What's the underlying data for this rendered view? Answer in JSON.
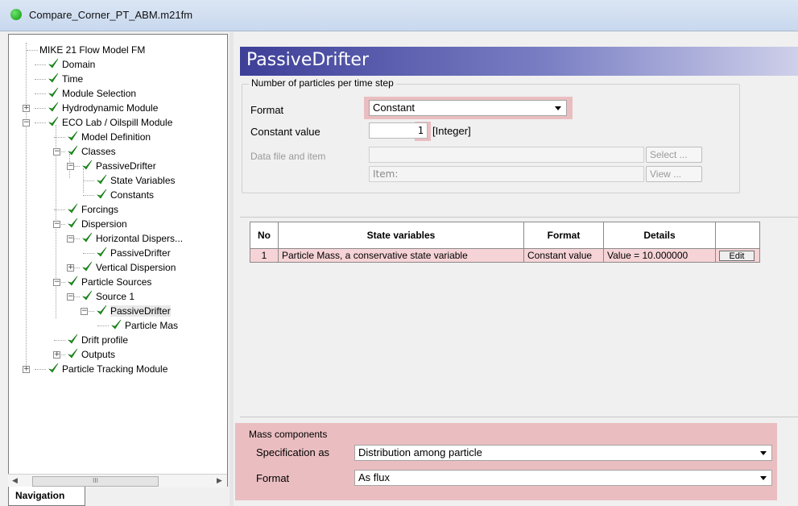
{
  "window": {
    "title": "Compare_Corner_PT_ABM.m21fm"
  },
  "navigation": {
    "tab_label": "Navigation",
    "scroll_thumb_glyph": "III",
    "tree": [
      {
        "label": "MIKE 21 Flow Model FM",
        "check": false
      },
      {
        "label": "Domain",
        "check": true
      },
      {
        "label": "Time",
        "check": true
      },
      {
        "label": "Module Selection",
        "check": true
      },
      {
        "label": "Hydrodynamic Module",
        "check": true,
        "expander": "+"
      },
      {
        "label": "ECO Lab / Oilspill Module",
        "check": true,
        "expander": "−"
      },
      {
        "label": "Model Definition",
        "check": true
      },
      {
        "label": "Classes",
        "check": true,
        "expander": "−"
      },
      {
        "label": "PassiveDrifter",
        "check": true,
        "expander": "−"
      },
      {
        "label": "State Variables",
        "check": true
      },
      {
        "label": "Constants",
        "check": true
      },
      {
        "label": "Forcings",
        "check": true
      },
      {
        "label": "Dispersion",
        "check": true,
        "expander": "−"
      },
      {
        "label": "Horizontal Dispers...",
        "check": true,
        "expander": "−"
      },
      {
        "label": "PassiveDrifter",
        "check": true
      },
      {
        "label": "Vertical Dispersion",
        "check": true,
        "expander": "+"
      },
      {
        "label": "Particle Sources",
        "check": true,
        "expander": "−"
      },
      {
        "label": "Source 1",
        "check": true,
        "expander": "−"
      },
      {
        "label": "PassiveDrifter",
        "check": true,
        "expander": "−",
        "selected": true
      },
      {
        "label": "Particle Mas",
        "check": true
      },
      {
        "label": "Drift profile",
        "check": true
      },
      {
        "label": "Outputs",
        "check": true,
        "expander": "+"
      },
      {
        "label": "Particle Tracking Module",
        "check": true,
        "expander": "+"
      }
    ]
  },
  "panel": {
    "title": "PassiveDrifter",
    "particles_group": {
      "legend": "Number of particles per time step",
      "format_label": "Format",
      "format_value": "Constant",
      "constant_label": "Constant value",
      "constant_value": "1",
      "constant_unit": "[Integer]",
      "datafile_label": "Data file and item",
      "select_button": "Select ...",
      "item_text": "Item:",
      "view_button": "View ..."
    },
    "table": {
      "headers": [
        "No",
        "State variables",
        "Format",
        "Details",
        ""
      ],
      "rows": [
        {
          "no": "1",
          "state_variable": "Particle Mass, a conservative state variable",
          "format": "Constant value",
          "details": "Value = 10.000000",
          "action": "Edit"
        }
      ]
    },
    "mass_group": {
      "legend": "Mass components",
      "spec_label": "Specification as",
      "spec_value": "Distribution among particle",
      "format_label": "Format",
      "format_value": "As flux"
    }
  },
  "colors": {
    "header_gradient_start": "#3d3f98",
    "highlight": "#e6969b",
    "check_green": "#1a9a1a"
  }
}
